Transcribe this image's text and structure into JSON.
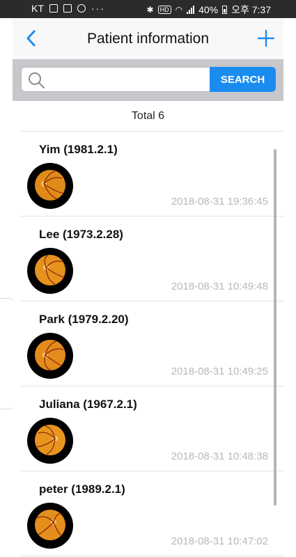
{
  "status_bar": {
    "carrier": "KT",
    "battery": "40%",
    "time": "오후 7:37",
    "hd_label": "HD",
    "dots": "···"
  },
  "header": {
    "title": "Patient information",
    "back_icon": "chevron-left-icon",
    "add_icon": "plus-icon"
  },
  "search": {
    "placeholder": "",
    "value": "",
    "button_label": "SEARCH"
  },
  "total_label": "Total 6",
  "patients": [
    {
      "name": "Yim (1981.2.1)",
      "date": "2018-08-31 19:36:45"
    },
    {
      "name": "Lee (1973.2.28)",
      "date": "2018-08-31 10:49:48"
    },
    {
      "name": "Park (1979.2.20)",
      "date": "2018-08-31 10:49:25"
    },
    {
      "name": "Juliana (1967.2.1)",
      "date": "2018-08-31 10:48:38"
    },
    {
      "name": "peter (1989.2.1)",
      "date": "2018-08-31 10:47:02"
    }
  ],
  "colors": {
    "accent": "#1a8cf0",
    "search_bar_bg": "#c8c8cc",
    "date_text": "#b8b8b8"
  }
}
